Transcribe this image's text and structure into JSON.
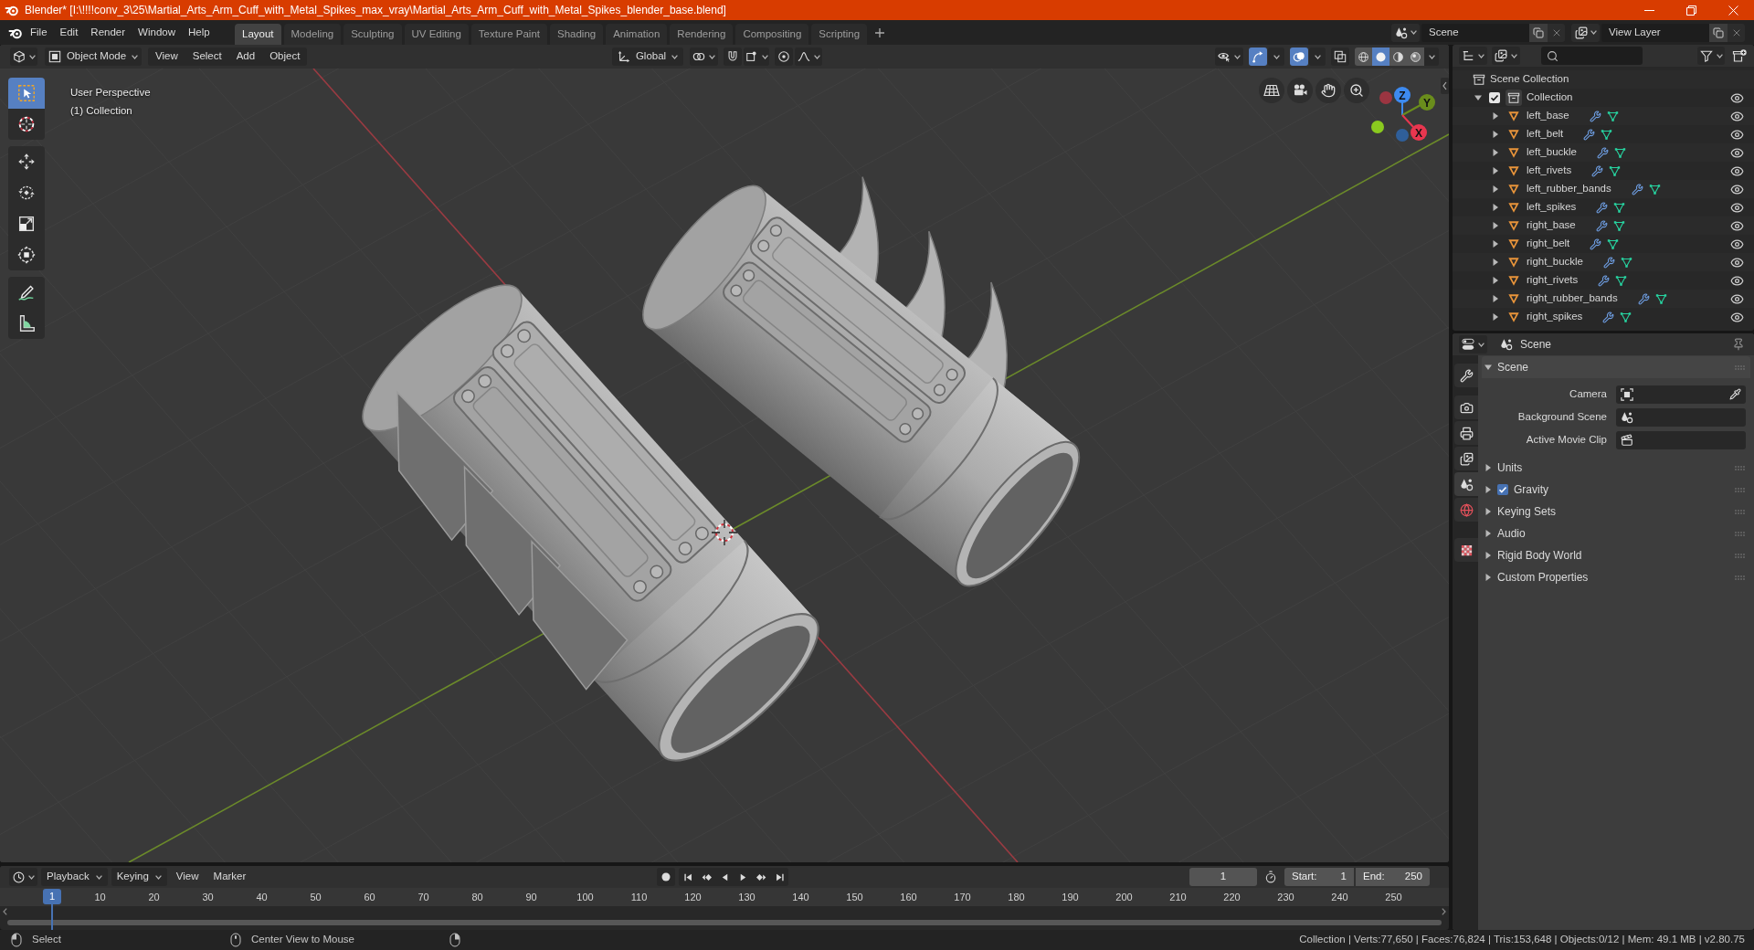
{
  "title_bar": {
    "title": "Blender* [I:\\!!!!conv_3\\25\\Martial_Arts_Arm_Cuff_with_Metal_Spikes_max_vray\\Martial_Arts_Arm_Cuff_with_Metal_Spikes_blender_base.blend]"
  },
  "top_bar": {
    "menus": [
      "File",
      "Edit",
      "Render",
      "Window",
      "Help"
    ],
    "workspaces": [
      {
        "label": "Layout",
        "selected": true
      },
      {
        "label": "Modeling",
        "selected": false
      },
      {
        "label": "Sculpting",
        "selected": false
      },
      {
        "label": "UV Editing",
        "selected": false
      },
      {
        "label": "Texture Paint",
        "selected": false
      },
      {
        "label": "Shading",
        "selected": false
      },
      {
        "label": "Animation",
        "selected": false
      },
      {
        "label": "Rendering",
        "selected": false
      },
      {
        "label": "Compositing",
        "selected": false
      },
      {
        "label": "Scripting",
        "selected": false
      }
    ],
    "scene": "Scene",
    "view_layer": "View Layer"
  },
  "viewport": {
    "header": {
      "mode": "Object Mode",
      "menus": [
        "View",
        "Select",
        "Add",
        "Object"
      ],
      "orientation": "Global",
      "toggles": [
        {
          "kind": "snap",
          "on": false
        },
        {
          "kind": "proportional",
          "on": false
        }
      ],
      "display": [
        {
          "kind": "visibility",
          "on": false
        },
        {
          "kind": "gizmos",
          "on": true
        },
        {
          "kind": "overlays",
          "on": true
        },
        {
          "kind": "xray",
          "on": false
        }
      ],
      "shading": [
        {
          "kind": "wireframe",
          "selected": false
        },
        {
          "kind": "solid",
          "selected": true
        },
        {
          "kind": "material",
          "selected": false
        },
        {
          "kind": "rendered",
          "selected": false
        }
      ]
    },
    "tool_groups": [
      {
        "tools": [
          {
            "kind": "select_box",
            "selected": true
          },
          {
            "kind": "cursor",
            "selected": false
          }
        ]
      },
      {
        "tools": [
          {
            "kind": "move",
            "selected": false
          },
          {
            "kind": "rotate",
            "selected": false
          },
          {
            "kind": "scale",
            "selected": false
          },
          {
            "kind": "transform",
            "selected": false
          }
        ]
      },
      {
        "tools": [
          {
            "kind": "annotate",
            "selected": false
          },
          {
            "kind": "measure",
            "selected": false
          }
        ]
      }
    ],
    "info": [
      "User Perspective",
      "(1) Collection"
    ],
    "axes": {
      "x": "X",
      "y": "Y",
      "z": "Z"
    }
  },
  "timeline": {
    "menus": [
      {
        "label": "Playback",
        "kind": "dropdown"
      },
      {
        "label": "Keying",
        "kind": "dropdown"
      },
      {
        "label": "View",
        "kind": "menu"
      },
      {
        "label": "Marker",
        "kind": "menu"
      }
    ],
    "current_frame": "1",
    "start_label": "Start:",
    "start": "1",
    "end_label": "End:",
    "end": "250",
    "ruler": [
      "10",
      "20",
      "30",
      "40",
      "50",
      "60",
      "70",
      "80",
      "90",
      "100",
      "110",
      "120",
      "130",
      "140",
      "150",
      "160",
      "170",
      "180",
      "190",
      "200",
      "210",
      "220",
      "230",
      "240",
      "250"
    ],
    "playhead": "1"
  },
  "outliner": {
    "root": "Scene Collection",
    "collections": [
      {
        "name": "Collection",
        "expanded": true,
        "checked": true,
        "visible": true,
        "children": [
          {
            "name": "left_base",
            "expanded": false,
            "visible": true
          },
          {
            "name": "left_belt",
            "expanded": false,
            "visible": true
          },
          {
            "name": "left_buckle",
            "expanded": false,
            "visible": true
          },
          {
            "name": "left_rivets",
            "expanded": false,
            "visible": true
          },
          {
            "name": "left_rubber_bands",
            "expanded": false,
            "visible": true
          },
          {
            "name": "left_spikes",
            "expanded": false,
            "visible": true
          },
          {
            "name": "right_base",
            "expanded": false,
            "visible": true
          },
          {
            "name": "right_belt",
            "expanded": false,
            "visible": true
          },
          {
            "name": "right_buckle",
            "expanded": false,
            "visible": true
          },
          {
            "name": "right_rivets",
            "expanded": false,
            "visible": true
          },
          {
            "name": "right_rubber_bands",
            "expanded": false,
            "visible": true
          },
          {
            "name": "right_spikes",
            "expanded": false,
            "visible": true
          }
        ]
      }
    ]
  },
  "properties": {
    "context": "Scene",
    "tab_groups": [
      {
        "tabs": [
          {
            "kind": "tool",
            "selected": false
          }
        ]
      },
      {
        "tabs": [
          {
            "kind": "render",
            "selected": false
          },
          {
            "kind": "output",
            "selected": false
          },
          {
            "kind": "view_layer",
            "selected": false
          },
          {
            "kind": "scene",
            "selected": true
          },
          {
            "kind": "world",
            "selected": false
          }
        ]
      },
      {
        "tabs": [
          {
            "kind": "texture",
            "selected": false
          }
        ]
      }
    ],
    "panel": {
      "title": "Scene",
      "expanded": true,
      "fields": [
        {
          "label": "Camera",
          "kind": "camera"
        },
        {
          "label": "Background Scene",
          "kind": "scene"
        },
        {
          "label": "Active Movie Clip",
          "kind": "clip"
        }
      ]
    },
    "subpanels": [
      {
        "title": "Units",
        "expanded": false,
        "kind": "plain"
      },
      {
        "title": "Gravity",
        "expanded": false,
        "kind": "checkbox",
        "checked": true
      },
      {
        "title": "Keying Sets",
        "expanded": false,
        "kind": "plain"
      },
      {
        "title": "Audio",
        "expanded": false,
        "kind": "plain"
      },
      {
        "title": "Rigid Body World",
        "expanded": false,
        "kind": "plain"
      },
      {
        "title": "Custom Properties",
        "expanded": false,
        "kind": "plain"
      }
    ]
  },
  "status_bar": {
    "hints": [
      {
        "kind": "left_click",
        "label": "Select"
      },
      {
        "kind": "middle_click",
        "label": "Center View to Mouse"
      },
      {
        "kind": "right_click"
      }
    ],
    "stats": "Collection | Verts:77,650 | Faces:76,824 | Tris:153,648 | Objects:0/12 | Mem: 49.1 MB | v2.80.75"
  }
}
